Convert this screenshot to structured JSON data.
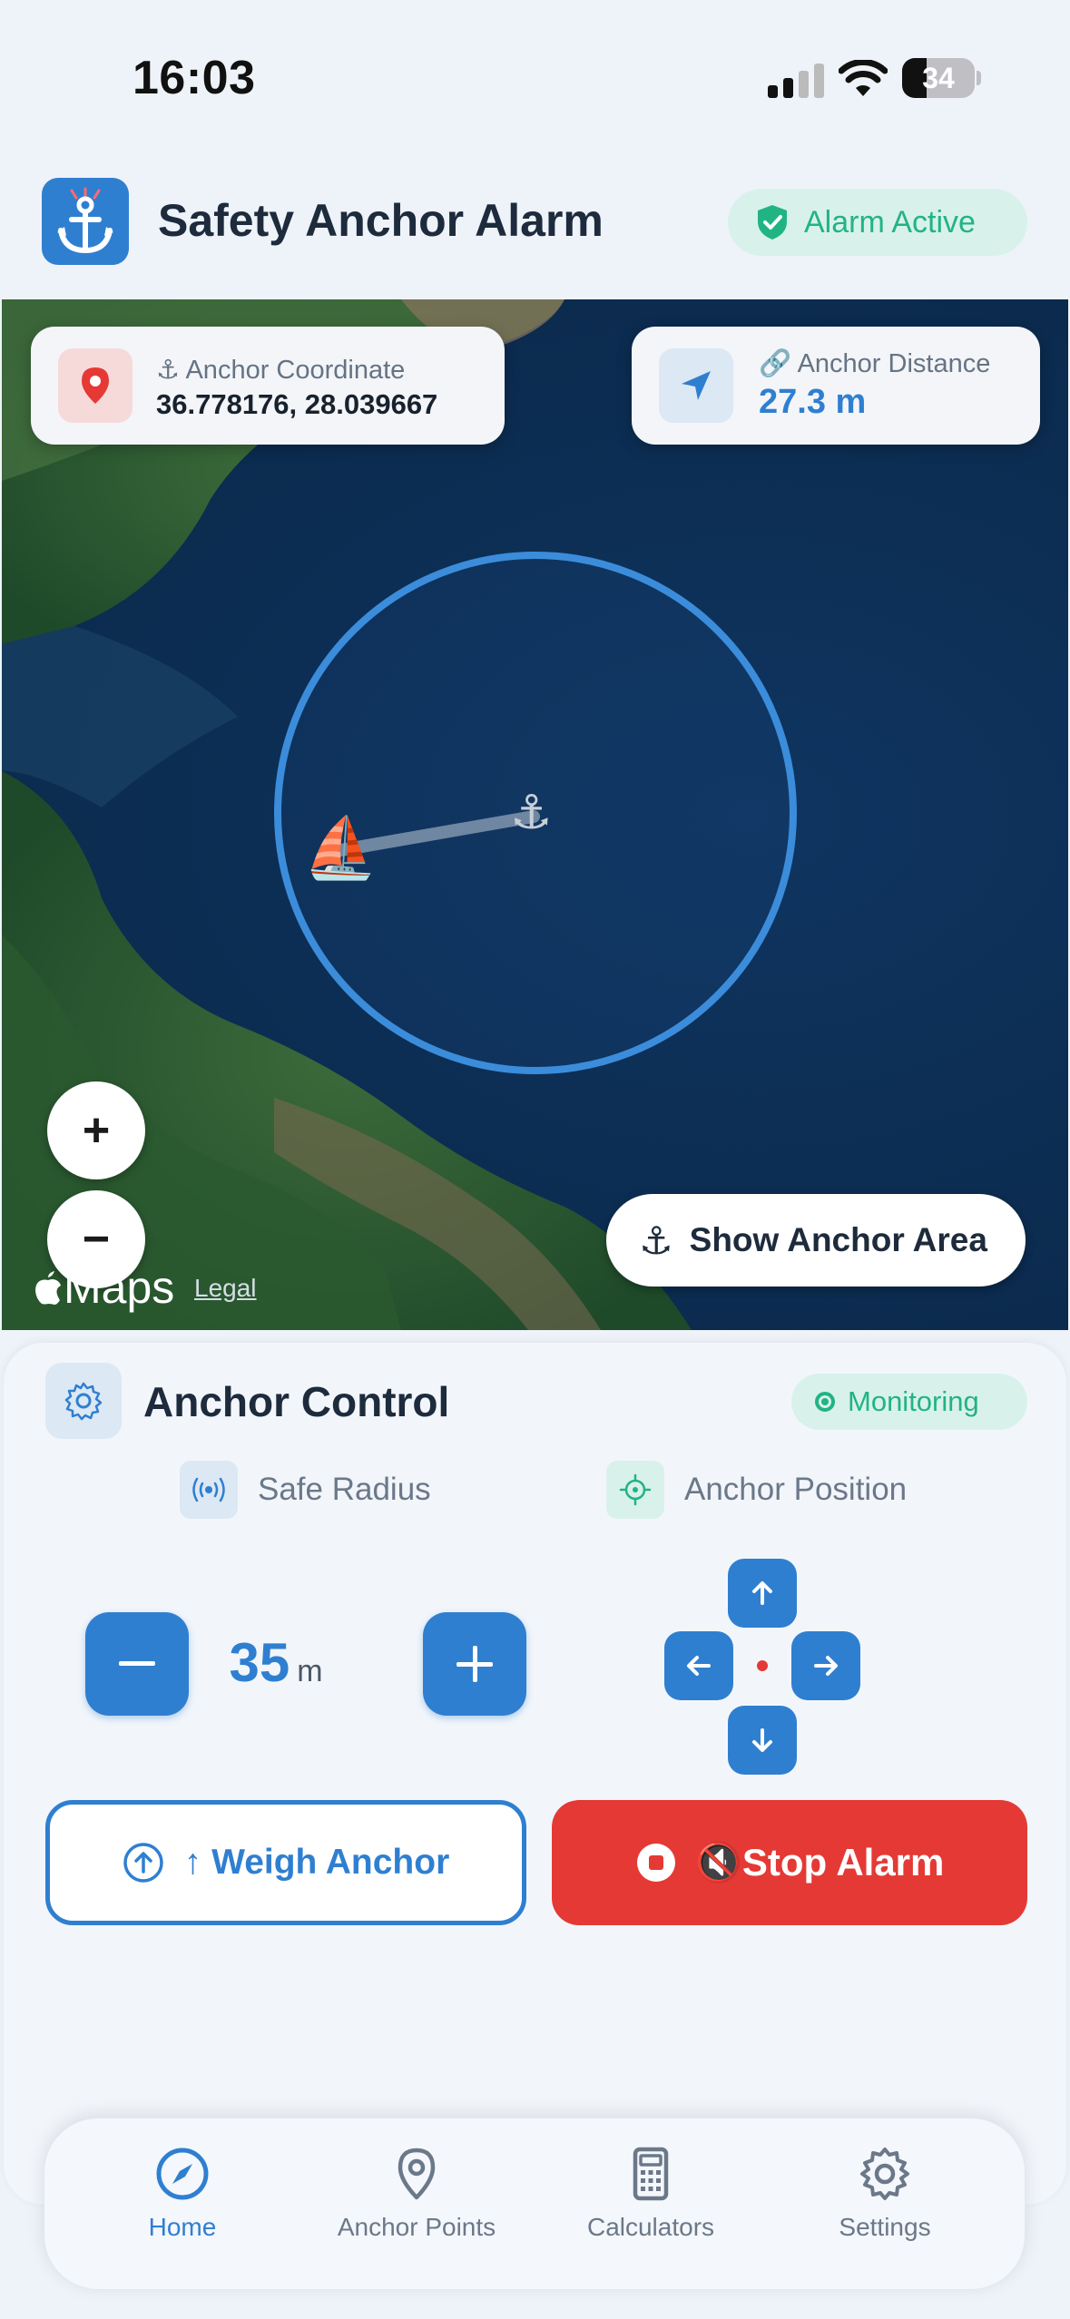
{
  "status_bar": {
    "time": "16:03",
    "battery": "34",
    "battery_level": 0.34
  },
  "header": {
    "title": "Safety Anchor Alarm",
    "alarm_badge": "Alarm Active"
  },
  "map": {
    "coordinate_label": "Anchor Coordinate",
    "coordinate_value": "36.778176, 28.039667",
    "distance_label": "Anchor Distance",
    "distance_value": "27.3 m",
    "zoom_in": "+",
    "zoom_out": "−",
    "maps_brand": "Maps",
    "legal": "Legal",
    "show_area_label": "Show Anchor Area",
    "boat_icon": "⛵",
    "anchor_icon": "⚓"
  },
  "control": {
    "title": "Anchor Control",
    "status_badge": "Monitoring",
    "safe_radius_label": "Safe Radius",
    "anchor_position_label": "Anchor Position",
    "radius_value": "35",
    "radius_unit": "m",
    "weigh_label": "↑ Weigh Anchor",
    "stop_label": "🔇Stop Alarm"
  },
  "tabs": [
    {
      "label": "Home",
      "icon": "compass-icon",
      "active": true
    },
    {
      "label": "Anchor Points",
      "icon": "map-pin-icon",
      "active": false
    },
    {
      "label": "Calculators",
      "icon": "calculator-icon",
      "active": false
    },
    {
      "label": "Settings",
      "icon": "gear-icon",
      "active": false
    }
  ],
  "colors": {
    "accent": "#2f7fd1",
    "success": "#21b483",
    "danger": "#e53935"
  }
}
